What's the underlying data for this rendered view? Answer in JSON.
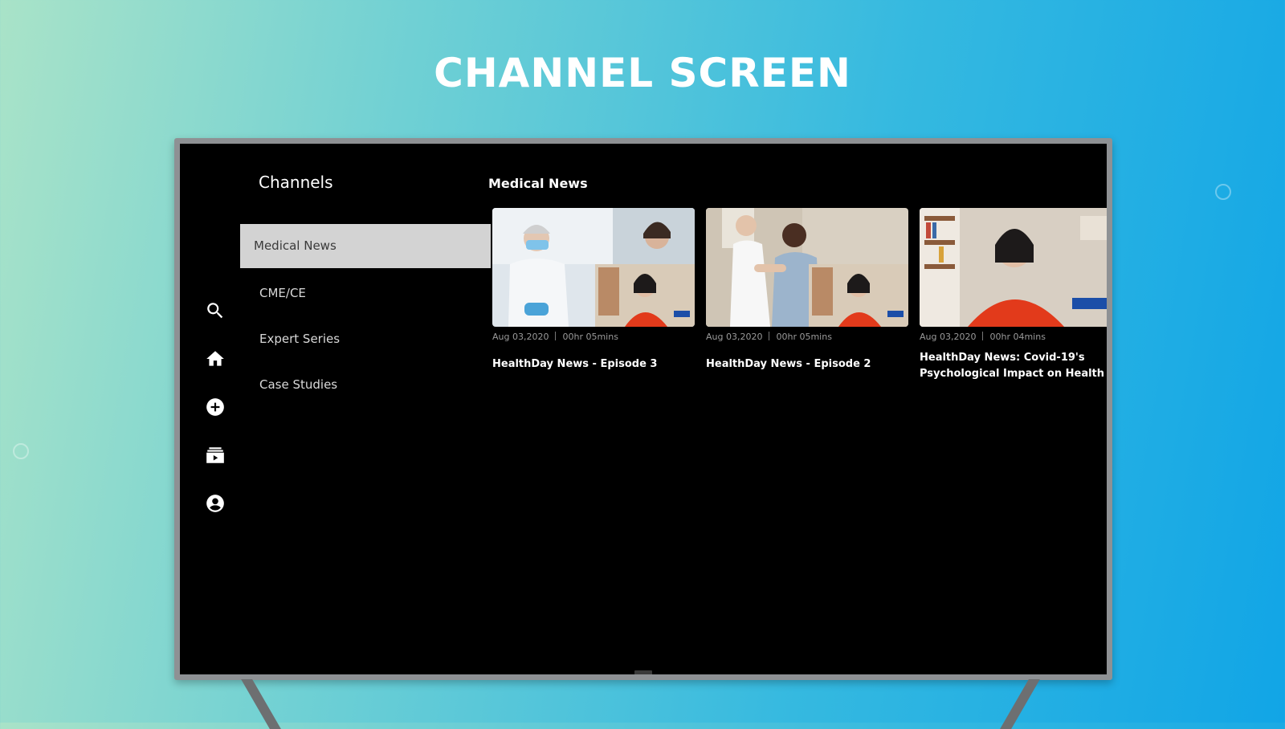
{
  "headline": "CHANNEL SCREEN",
  "rail": {
    "icons": [
      "search-icon",
      "home-icon",
      "add-circle-icon",
      "library-icon",
      "account-icon"
    ]
  },
  "channels": {
    "title": "Channels",
    "items": [
      {
        "label": "Medical News",
        "active": true
      },
      {
        "label": "CME/CE",
        "active": false
      },
      {
        "label": "Expert Series",
        "active": false
      },
      {
        "label": "Case Studies",
        "active": false
      }
    ]
  },
  "section": {
    "title": "Medical News",
    "videos": [
      {
        "date": "Aug 03,2020",
        "duration": "00hr 05mins",
        "title": "HealthDay News - Episode 3"
      },
      {
        "date": "Aug 03,2020",
        "duration": "00hr 05mins",
        "title": "HealthDay News - Episode 2"
      },
      {
        "date": "Aug 03,2020",
        "duration": "00hr 04mins",
        "title": "HealthDay News: Covid-19's Psychological Impact on Health"
      }
    ]
  },
  "colors": {
    "accent_selected": "#d3d3d3",
    "screen_bg": "#000000",
    "bezel": "#8e9194"
  }
}
